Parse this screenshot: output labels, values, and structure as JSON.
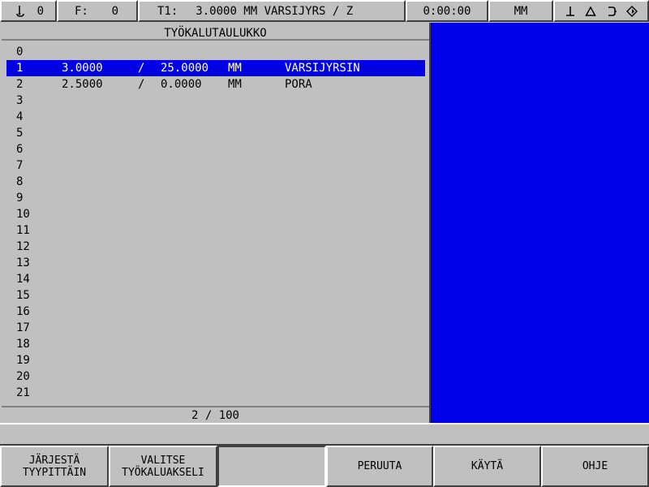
{
  "status_bar": {
    "spindle_icon": "spindle-icon",
    "spindle_value": "0",
    "feed_label": "F:",
    "feed_value": "0",
    "tool_label": "T1:",
    "tool_info": "3.0000 MM VARSIJYRS / Z",
    "time": "0:00:00",
    "unit": "MM",
    "icons": [
      "datum-icon",
      "delta-icon",
      "bracket-icon",
      "diamond-icon"
    ]
  },
  "tool_table": {
    "title": "TYÖKALUTAULUKKO",
    "rows": [
      {
        "num": "0",
        "diameter": "",
        "sep": "",
        "length": "",
        "unit": "",
        "type": ""
      },
      {
        "num": "1",
        "diameter": "3.0000",
        "sep": "/",
        "length": "25.0000",
        "unit": "MM",
        "type": "VARSIJYRSIN"
      },
      {
        "num": "2",
        "diameter": "2.5000",
        "sep": "/",
        "length": "0.0000",
        "unit": "MM",
        "type": "PORA"
      },
      {
        "num": "3",
        "diameter": "",
        "sep": "",
        "length": "",
        "unit": "",
        "type": ""
      },
      {
        "num": "4",
        "diameter": "",
        "sep": "",
        "length": "",
        "unit": "",
        "type": ""
      },
      {
        "num": "5",
        "diameter": "",
        "sep": "",
        "length": "",
        "unit": "",
        "type": ""
      },
      {
        "num": "6",
        "diameter": "",
        "sep": "",
        "length": "",
        "unit": "",
        "type": ""
      },
      {
        "num": "7",
        "diameter": "",
        "sep": "",
        "length": "",
        "unit": "",
        "type": ""
      },
      {
        "num": "8",
        "diameter": "",
        "sep": "",
        "length": "",
        "unit": "",
        "type": ""
      },
      {
        "num": "9",
        "diameter": "",
        "sep": "",
        "length": "",
        "unit": "",
        "type": ""
      },
      {
        "num": "10",
        "diameter": "",
        "sep": "",
        "length": "",
        "unit": "",
        "type": ""
      },
      {
        "num": "11",
        "diameter": "",
        "sep": "",
        "length": "",
        "unit": "",
        "type": ""
      },
      {
        "num": "12",
        "diameter": "",
        "sep": "",
        "length": "",
        "unit": "",
        "type": ""
      },
      {
        "num": "13",
        "diameter": "",
        "sep": "",
        "length": "",
        "unit": "",
        "type": ""
      },
      {
        "num": "14",
        "diameter": "",
        "sep": "",
        "length": "",
        "unit": "",
        "type": ""
      },
      {
        "num": "15",
        "diameter": "",
        "sep": "",
        "length": "",
        "unit": "",
        "type": ""
      },
      {
        "num": "16",
        "diameter": "",
        "sep": "",
        "length": "",
        "unit": "",
        "type": ""
      },
      {
        "num": "17",
        "diameter": "",
        "sep": "",
        "length": "",
        "unit": "",
        "type": ""
      },
      {
        "num": "18",
        "diameter": "",
        "sep": "",
        "length": "",
        "unit": "",
        "type": ""
      },
      {
        "num": "19",
        "diameter": "",
        "sep": "",
        "length": "",
        "unit": "",
        "type": ""
      },
      {
        "num": "20",
        "diameter": "",
        "sep": "",
        "length": "",
        "unit": "",
        "type": ""
      },
      {
        "num": "21",
        "diameter": "",
        "sep": "",
        "length": "",
        "unit": "",
        "type": ""
      }
    ],
    "selected_index": 1,
    "pager": "2 / 100"
  },
  "colors": {
    "highlight": "#0000e0",
    "graphic_pane": "#0000e8",
    "panel": "#c0c0c0"
  },
  "message_line": "",
  "softkeys": [
    {
      "line1": "JÄRJESTÄ",
      "line2": "TYYPITTÄIN"
    },
    {
      "line1": "VALITSE",
      "line2": "TYÖKALUAKSELI"
    },
    {
      "line1": "",
      "line2": ""
    },
    {
      "line1": "PERUUTA",
      "line2": ""
    },
    {
      "line1": "KÄYTÄ",
      "line2": ""
    },
    {
      "line1": "OHJE",
      "line2": ""
    }
  ]
}
